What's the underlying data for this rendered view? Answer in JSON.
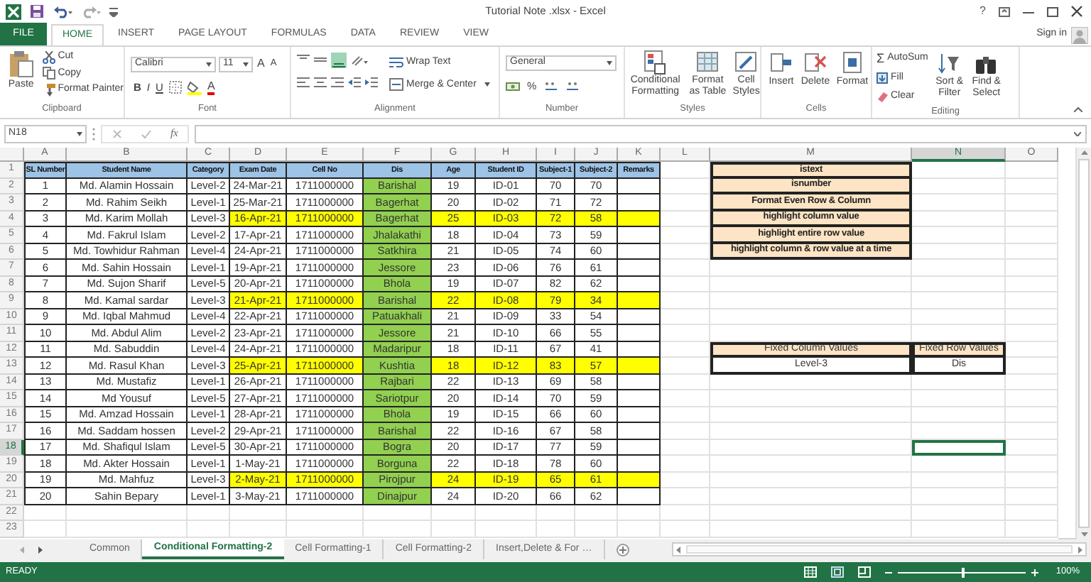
{
  "window": {
    "title": "Tutorial Note .xlsx - Excel",
    "help": "?",
    "sign_in": "Sign in"
  },
  "ribbon_tabs": [
    {
      "label": "FILE",
      "kind": "file",
      "selected": false
    },
    {
      "label": "HOME",
      "kind": "tab",
      "selected": true
    },
    {
      "label": "INSERT",
      "kind": "tab",
      "selected": false
    },
    {
      "label": "PAGE LAYOUT",
      "kind": "tab",
      "selected": false
    },
    {
      "label": "FORMULAS",
      "kind": "tab",
      "selected": false
    },
    {
      "label": "DATA",
      "kind": "tab",
      "selected": false
    },
    {
      "label": "REVIEW",
      "kind": "tab",
      "selected": false
    },
    {
      "label": "VIEW",
      "kind": "tab",
      "selected": false
    }
  ],
  "ribbon": {
    "clipboard": {
      "label": "Clipboard",
      "paste": "Paste",
      "cut": "Cut",
      "copy": "Copy",
      "format_painter": "Format Painter"
    },
    "font": {
      "label": "Font",
      "name": "Calibri",
      "size": "11",
      "grow": "A",
      "shrink": "A",
      "bold": "B",
      "italic": "I",
      "underline": "U",
      "font_color_button": "A"
    },
    "alignment": {
      "label": "Alignment",
      "wrap_text": "Wrap Text",
      "merge_center": "Merge & Center"
    },
    "number": {
      "label": "Number",
      "format": "General",
      "percent": "%"
    },
    "styles": {
      "label": "Styles",
      "conditional_formatting": "Conditional Formatting",
      "format_as_table": "Format as Table",
      "cell_styles": "Cell Styles"
    },
    "cells": {
      "label": "Cells",
      "insert": "Insert",
      "delete": "Delete",
      "format": "Format"
    },
    "editing": {
      "label": "Editing",
      "sigma": "Σ",
      "autosum": "AutoSum",
      "fill": "Fill",
      "clear": "Clear",
      "sort_filter": "Sort & Filter",
      "find_select": "Find & Select"
    }
  },
  "formula_bar": {
    "name_box": "N18",
    "function_symbol": "fx"
  },
  "columns": [
    {
      "label": "A",
      "selected": false
    },
    {
      "label": "B",
      "selected": false
    },
    {
      "label": "C",
      "selected": false
    },
    {
      "label": "D",
      "selected": false
    },
    {
      "label": "E",
      "selected": false
    },
    {
      "label": "F",
      "selected": false
    },
    {
      "label": "G",
      "selected": false
    },
    {
      "label": "H",
      "selected": false
    },
    {
      "label": "I",
      "selected": false
    },
    {
      "label": "J",
      "selected": false
    },
    {
      "label": "K",
      "selected": false
    },
    {
      "label": "L",
      "selected": false
    },
    {
      "label": "M",
      "selected": false
    },
    {
      "label": "N",
      "selected": true
    },
    {
      "label": "O",
      "selected": false
    }
  ],
  "rows": [
    {
      "label": "1",
      "selected": false
    },
    {
      "label": "2",
      "selected": false
    },
    {
      "label": "3",
      "selected": false
    },
    {
      "label": "4",
      "selected": false
    },
    {
      "label": "5",
      "selected": false
    },
    {
      "label": "6",
      "selected": false
    },
    {
      "label": "7",
      "selected": false
    },
    {
      "label": "8",
      "selected": false
    },
    {
      "label": "9",
      "selected": false
    },
    {
      "label": "10",
      "selected": false
    },
    {
      "label": "11",
      "selected": false
    },
    {
      "label": "12",
      "selected": false
    },
    {
      "label": "13",
      "selected": false
    },
    {
      "label": "14",
      "selected": false
    },
    {
      "label": "15",
      "selected": false
    },
    {
      "label": "16",
      "selected": false
    },
    {
      "label": "17",
      "selected": false
    },
    {
      "label": "18",
      "selected": true
    },
    {
      "label": "19",
      "selected": false
    },
    {
      "label": "20",
      "selected": false
    },
    {
      "label": "21",
      "selected": false
    },
    {
      "label": "22",
      "selected": false
    },
    {
      "label": "23",
      "selected": false
    }
  ],
  "table": {
    "columns": [
      "SL Number",
      "Student Name",
      "Category",
      "Exam Date",
      "Cell No",
      "Dis",
      "Age",
      "Student ID",
      "Subject-1",
      "Subject-2",
      "Remarks"
    ],
    "rows": [
      {
        "cells": [
          "1",
          "Md. Alamin Hossain",
          "Level-2",
          "24-Mar-21",
          "1711000000",
          "Barishal",
          "19",
          "ID-01",
          "70",
          "70"
        ],
        "highlighted": false
      },
      {
        "cells": [
          "2",
          "Md. Rahim Seikh",
          "Level-1",
          "25-Mar-21",
          "1711000000",
          "Bagerhat",
          "20",
          "ID-02",
          "71",
          "72"
        ],
        "highlighted": false
      },
      {
        "cells": [
          "3",
          "Md. Karim Mollah",
          "Level-3",
          "16-Apr-21",
          "1711000000",
          "Bagerhat",
          "25",
          "ID-03",
          "72",
          "58"
        ],
        "highlighted": true
      },
      {
        "cells": [
          "4",
          "Md. Fakrul Islam",
          "Level-2",
          "17-Apr-21",
          "1711000000",
          "Jhalakathi",
          "18",
          "ID-04",
          "73",
          "59"
        ],
        "highlighted": false
      },
      {
        "cells": [
          "5",
          "Md. Towhidur Rahman",
          "Level-4",
          "24-Apr-21",
          "1711000000",
          "Satkhira",
          "21",
          "ID-05",
          "74",
          "60"
        ],
        "highlighted": false
      },
      {
        "cells": [
          "6",
          "Md. Sahin Hossain",
          "Level-1",
          "19-Apr-21",
          "1711000000",
          "Jessore",
          "23",
          "ID-06",
          "76",
          "61"
        ],
        "highlighted": false
      },
      {
        "cells": [
          "7",
          "Md. Sujon Sharif",
          "Level-5",
          "20-Apr-21",
          "1711000000",
          "Bhola",
          "19",
          "ID-07",
          "82",
          "62"
        ],
        "highlighted": false
      },
      {
        "cells": [
          "8",
          "Md. Kamal sardar",
          "Level-3",
          "21-Apr-21",
          "1711000000",
          "Barishal",
          "22",
          "ID-08",
          "79",
          "34"
        ],
        "highlighted": true
      },
      {
        "cells": [
          "9",
          "Md. Iqbal Mahmud",
          "Level-4",
          "22-Apr-21",
          "1711000000",
          "Patuakhali",
          "21",
          "ID-09",
          "33",
          "54"
        ],
        "highlighted": false
      },
      {
        "cells": [
          "10",
          "Md. Abdul Alim",
          "Level-2",
          "23-Apr-21",
          "1711000000",
          "Jessore",
          "21",
          "ID-10",
          "66",
          "55"
        ],
        "highlighted": false
      },
      {
        "cells": [
          "11",
          "Md. Sabuddin",
          "Level-4",
          "24-Apr-21",
          "1711000000",
          "Madaripur",
          "18",
          "ID-11",
          "67",
          "41"
        ],
        "highlighted": false
      },
      {
        "cells": [
          "12",
          "Md. Rasul Khan",
          "Level-3",
          "25-Apr-21",
          "1711000000",
          "Kushtia",
          "18",
          "ID-12",
          "83",
          "57"
        ],
        "highlighted": true
      },
      {
        "cells": [
          "13",
          "Md. Mustafiz",
          "Level-1",
          "26-Apr-21",
          "1711000000",
          "Rajbari",
          "22",
          "ID-13",
          "69",
          "58"
        ],
        "highlighted": false
      },
      {
        "cells": [
          "14",
          "Md Yousuf",
          "Level-5",
          "27-Apr-21",
          "1711000000",
          "Sariotpur",
          "20",
          "ID-14",
          "70",
          "59"
        ],
        "highlighted": false
      },
      {
        "cells": [
          "15",
          "Md. Amzad Hossain",
          "Level-1",
          "28-Apr-21",
          "1711000000",
          "Bhola",
          "19",
          "ID-15",
          "66",
          "60"
        ],
        "highlighted": false
      },
      {
        "cells": [
          "16",
          "Md. Saddam hossen",
          "Level-2",
          "29-Apr-21",
          "1711000000",
          "Barishal",
          "22",
          "ID-16",
          "67",
          "58"
        ],
        "highlighted": false
      },
      {
        "cells": [
          "17",
          "Md. Shafiqul Islam",
          "Level-5",
          "30-Apr-21",
          "1711000000",
          "Bogra",
          "20",
          "ID-17",
          "77",
          "59"
        ],
        "highlighted": false
      },
      {
        "cells": [
          "18",
          "Md. Akter Hossain",
          "Level-1",
          "1-May-21",
          "1711000000",
          "Borguna",
          "22",
          "ID-18",
          "78",
          "60"
        ],
        "highlighted": false
      },
      {
        "cells": [
          "19",
          "Md. Mahfuz",
          "Level-3",
          "2-May-21",
          "1711000000",
          "Pirojpur",
          "24",
          "ID-19",
          "65",
          "61"
        ],
        "highlighted": true
      },
      {
        "cells": [
          "20",
          "Sahin Bepary",
          "Level-1",
          "3-May-21",
          "1711000000",
          "Dinajpur",
          "24",
          "ID-20",
          "66",
          "62"
        ],
        "highlighted": false
      }
    ]
  },
  "function_list": [
    "istext",
    "isnumber",
    "Format Even Row & Column",
    "highlight column value",
    "highlight entire row value",
    "highlight column & row value at a time"
  ],
  "fixed_values": {
    "columns": [
      "Fixed Column Values",
      "Fixed Row Values"
    ],
    "values": [
      "Level-3",
      "Dis"
    ]
  },
  "sheet_tabs": [
    {
      "label": "Common",
      "selected": false
    },
    {
      "label": "Conditional Formatting-2",
      "selected": true
    },
    {
      "label": "Cell Formatting-1",
      "selected": false
    },
    {
      "label": "Cell Formatting-2",
      "selected": false
    },
    {
      "label": "Insert,Delete & For …",
      "selected": false
    }
  ],
  "status_bar": {
    "status": "READY",
    "zoom": "100%",
    "zoom_slider": {
      "level": 0.5
    }
  }
}
